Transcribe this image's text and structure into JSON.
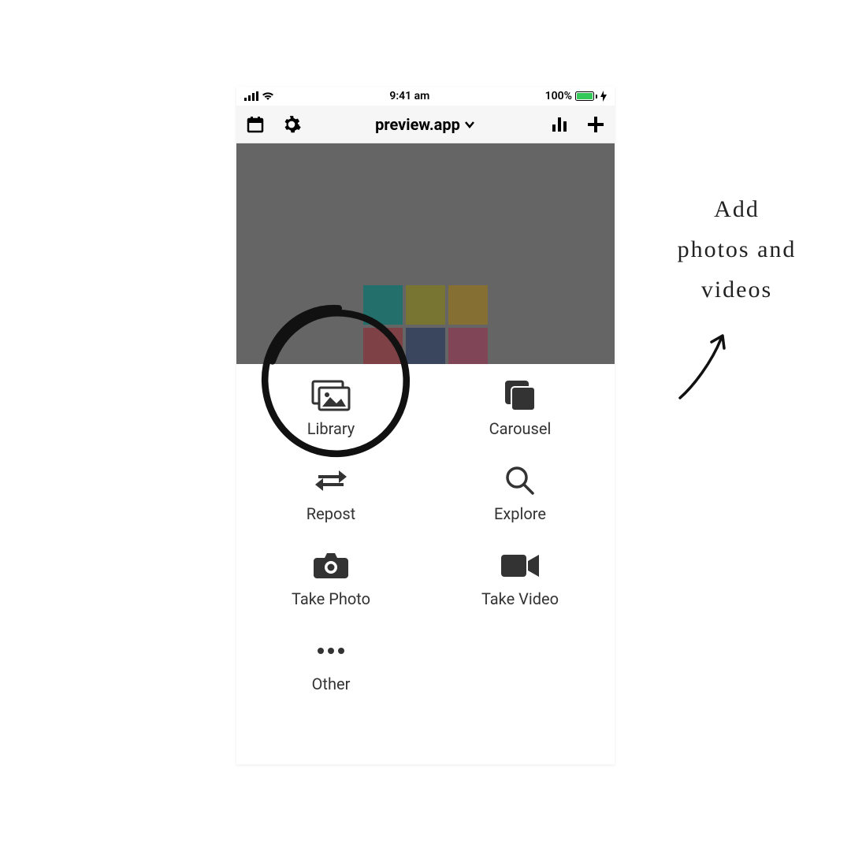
{
  "status": {
    "time": "9:41 am",
    "battery_text": "100%"
  },
  "nav": {
    "title": "preview.app"
  },
  "actions": {
    "library": "Library",
    "carousel": "Carousel",
    "repost": "Repost",
    "explore": "Explore",
    "take_photo": "Take Photo",
    "take_video": "Take Video",
    "other": "Other"
  },
  "annotation": {
    "line1": "Add",
    "line2": "photos and",
    "line3": "videos"
  }
}
